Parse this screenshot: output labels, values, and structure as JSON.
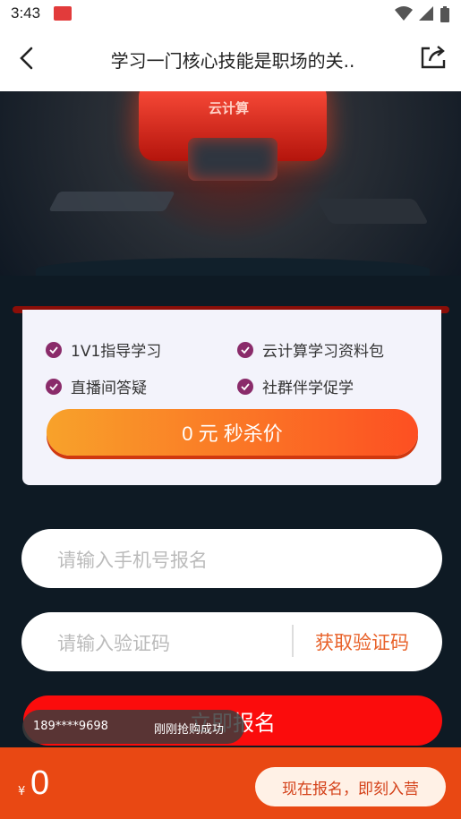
{
  "status": {
    "time": "3:43"
  },
  "nav": {
    "title": "学习一门核心技能是职场的关.."
  },
  "hero": {
    "label": "云计算"
  },
  "features": [
    "1V1指导学习",
    "云计算学习资料包",
    "直播间答疑",
    "社群伴学促学"
  ],
  "price_button": "0 元 秒杀价",
  "phone_field": {
    "placeholder": "请输入手机号报名"
  },
  "code_field": {
    "placeholder": "请输入验证码",
    "get_code": "获取验证码"
  },
  "submit": "立即报名",
  "toast": {
    "phone": "189****9698",
    "message": "刚刚抢购成功"
  },
  "footer": {
    "currency": "¥",
    "price": "0",
    "cta": "现在报名，即刻入营"
  }
}
